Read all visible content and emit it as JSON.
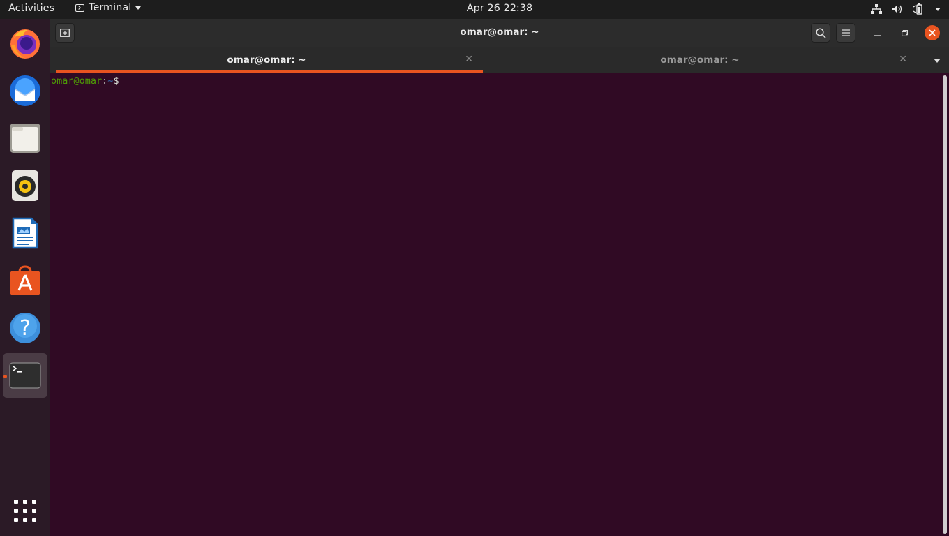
{
  "topbar": {
    "activities": "Activities",
    "app_menu": "Terminal",
    "clock": "Apr 26  22:38",
    "icons": [
      "network-icon",
      "volume-icon",
      "battery-icon",
      "system-menu-arrow"
    ]
  },
  "dock": {
    "items": [
      {
        "name": "Firefox",
        "icon": "firefox-icon"
      },
      {
        "name": "Thunderbird",
        "icon": "thunderbird-icon"
      },
      {
        "name": "Files",
        "icon": "files-icon"
      },
      {
        "name": "Rhythmbox",
        "icon": "rhythmbox-icon"
      },
      {
        "name": "LibreOffice Writer",
        "icon": "writer-icon"
      },
      {
        "name": "Ubuntu Software",
        "icon": "software-icon"
      },
      {
        "name": "Help",
        "icon": "help-icon"
      },
      {
        "name": "Terminal",
        "icon": "terminal-icon",
        "active": true
      }
    ],
    "show_apps_icon": "app-grid-icon"
  },
  "window": {
    "title": "omar@omar: ~",
    "accent": "#e95420"
  },
  "tabs": [
    {
      "label": "omar@omar: ~",
      "active": true
    },
    {
      "label": "omar@omar: ~",
      "active": false
    }
  ],
  "terminal": {
    "prompt_user": "omar@omar",
    "prompt_sep": ":",
    "prompt_path": "~",
    "prompt_symbol": "$",
    "background": "#300a24"
  }
}
